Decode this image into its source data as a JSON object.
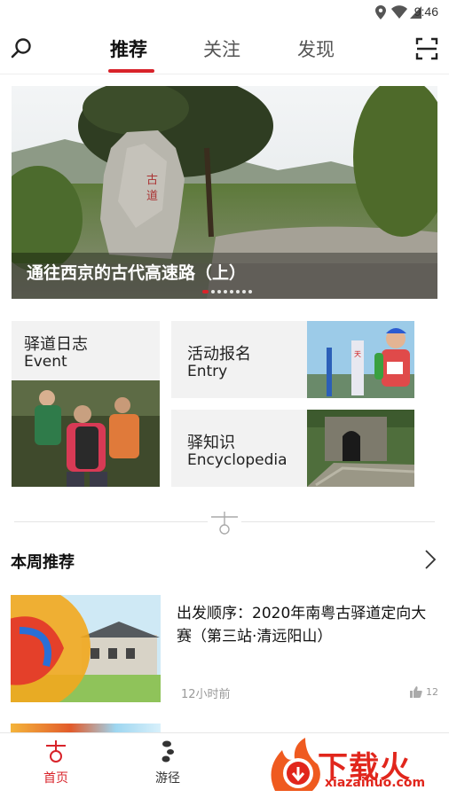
{
  "status_bar": {
    "time": "9:46"
  },
  "top_nav": {
    "tabs": [
      {
        "label": "推荐",
        "active": true
      },
      {
        "label": "关注",
        "active": false
      },
      {
        "label": "发现",
        "active": false
      }
    ]
  },
  "banner": {
    "caption": "通往西京的古代高速路（上）",
    "page_count": 8,
    "current_page": 1
  },
  "categories": [
    {
      "title": "驿道日志",
      "subtitle": "Event"
    },
    {
      "title": "活动报名",
      "subtitle": "Entry"
    },
    {
      "title": "驿知识",
      "subtitle": "Encyclopedia"
    }
  ],
  "section": {
    "title": "本周推荐"
  },
  "articles": [
    {
      "title": "出发顺序：2020年南粤古驿道定向大赛（第三站·清远阳山）",
      "time": "12小时前",
      "likes": "12"
    }
  ],
  "bottom_nav": {
    "items": [
      {
        "label": "首页",
        "active": true
      },
      {
        "label": "游径",
        "active": false
      }
    ]
  },
  "watermark": {
    "text": "下载火",
    "url": "xiazaihuo.com"
  },
  "colors": {
    "accent": "#d8232a",
    "card_bg": "#f2f2f2"
  }
}
